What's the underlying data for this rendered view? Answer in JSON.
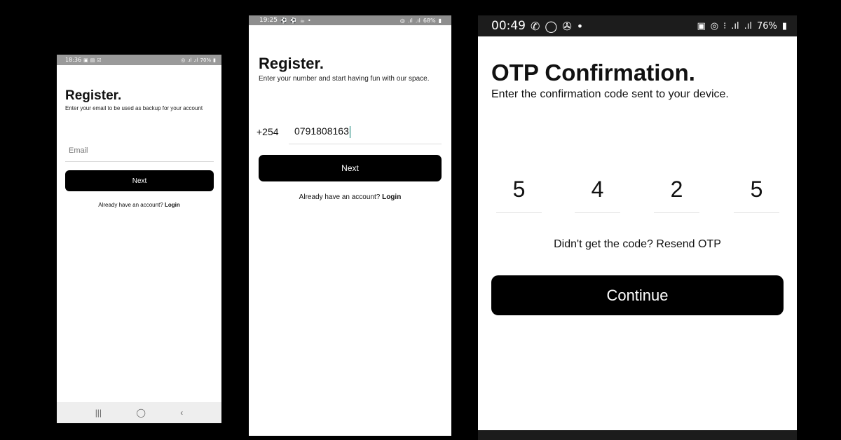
{
  "screens": [
    {
      "status": {
        "time": "18:36",
        "battery": "70%",
        "left_icons": [
          "sim-icon",
          "image-icon",
          "check-icon"
        ],
        "right_icons": [
          "hotspot-icon",
          "signal-icon",
          "signal-icon"
        ]
      },
      "title": "Register.",
      "subtitle": "Enter your email to be used as backup for your account",
      "email_placeholder": "Email",
      "next_label": "Next",
      "login_prompt": "Already have an account?",
      "login_link": "Login",
      "nav": {
        "recents": "|||",
        "home": "◯",
        "back": "‹"
      }
    },
    {
      "status": {
        "time": "19:25",
        "battery": "68%",
        "left_icons": [
          "soccer-icon",
          "soccer-icon",
          "cup-icon"
        ],
        "right_icons": [
          "hotspot-icon",
          "signal-icon",
          "signal-icon"
        ]
      },
      "title": "Register.",
      "subtitle": "Enter your number and start having fun with our space.",
      "country_code": "+254",
      "phone_value": "0791808163",
      "next_label": "Next",
      "login_prompt": "Already have an account?",
      "login_link": "Login"
    },
    {
      "status": {
        "time": "00:49",
        "battery": "76%",
        "left_icons": [
          "whatsapp-icon",
          "chat-icon",
          "fan-icon"
        ],
        "right_icons": [
          "sim-icon",
          "hotspot-icon",
          "volte-icon",
          "signal-icon",
          "signal-icon"
        ]
      },
      "title": "OTP Confirmation.",
      "subtitle": "Enter the confirmation code sent to your device.",
      "otp_digits": [
        "5",
        "4",
        "2",
        "5"
      ],
      "resend_text": "Didn't get the code? Resend OTP",
      "continue_label": "Continue"
    }
  ],
  "colors": {
    "button": "#000000",
    "button_text": "#ffffff",
    "background": "#000000"
  }
}
